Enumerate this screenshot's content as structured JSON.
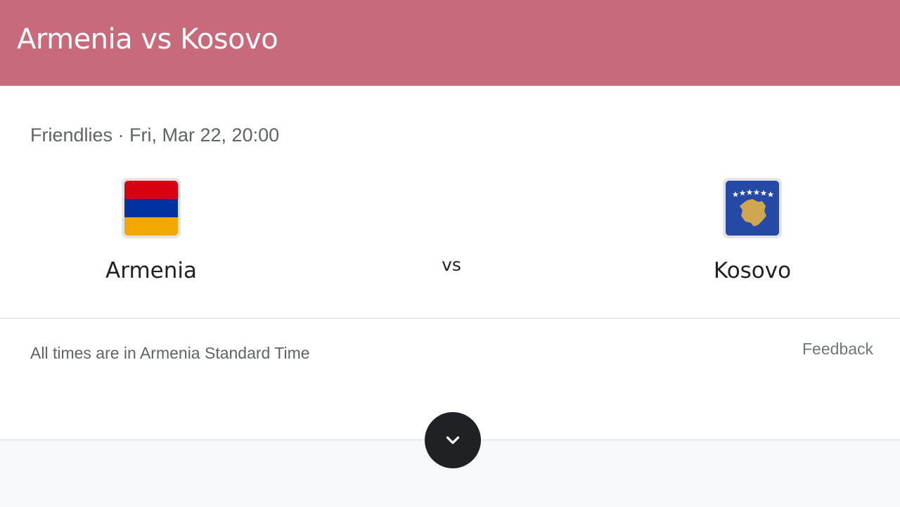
{
  "header": {
    "title": "Armenia vs Kosovo",
    "background_color": "#c96a7c"
  },
  "match": {
    "info": "Friendlies · Fri, Mar 22, 20:00",
    "vs_label": "vs",
    "home_team": {
      "name": "Armenia",
      "flag_icon": "armenia-flag-icon",
      "flag_colors": [
        "#d90012",
        "#0033a0",
        "#f2a800"
      ]
    },
    "away_team": {
      "name": "Kosovo",
      "flag_icon": "kosovo-flag-icon",
      "flag_colors": [
        "#244aa5",
        "#d0a650",
        "#ffffff"
      ]
    }
  },
  "footer": {
    "timezone_note": "All times are in Armenia Standard Time",
    "feedback_label": "Feedback",
    "expand_icon": "chevron-down-icon"
  }
}
